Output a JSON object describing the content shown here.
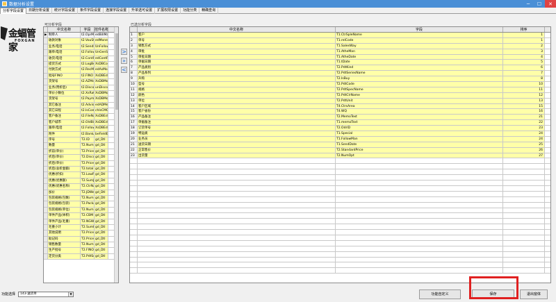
{
  "window": {
    "title": "数据分析设置",
    "min": "─",
    "max": "☐",
    "close": "✕"
  },
  "tabs": [
    "分析字段设置",
    "日期分析设置",
    "统计字段设置",
    "条件字段设置",
    "连接字段设置",
    "升单选可设置",
    "扩展权限设置",
    "功能分类",
    "精确查询"
  ],
  "logo": {
    "brand": "金蝠管家",
    "latin": "FOXGAN"
  },
  "left": {
    "group_label": "可分析字段",
    "headers": [
      "中文名称",
      "字段",
      "控件名称"
    ],
    "rows": [
      [
        "制单人",
        "t2.OprMan",
        "edBillMan"
      ],
      [
        "收款对象",
        "t2.VouState",
        "edMoneyObj"
      ],
      [
        "业务/电话",
        "t2.SendMan",
        "UnFollowM"
      ],
      [
        "跟单/电话",
        "t2.FollowMan",
        "UnGenSup"
      ],
      [
        "收货/电话",
        "t2.ContPhone",
        "edContPho"
      ],
      [
        "提货方式",
        "t2.LogBookId",
        "XsDBCombo"
      ],
      [
        "付款方式",
        "t2.RecMoney",
        "edAsMone"
      ],
      [
        "批号FINO",
        "t2.FINO",
        "XsDBEdit1"
      ],
      [
        "货架号",
        "t2.AZMoney",
        "XsDBMoney"
      ],
      [
        "业务(用折后)",
        "t2.Discount",
        "unDiscout"
      ],
      [
        "单价小数位",
        "t2.XsRate",
        "XsDBMoney"
      ],
      [
        "货架号",
        "t2.PaymentMode",
        "XsDBMoney"
      ],
      [
        "其它备注",
        "t2.Advising",
        "edADMemo"
      ],
      [
        "其它日程",
        "t2.IsCommon",
        "chIsCMO"
      ],
      [
        "客户备注",
        "t2.FileName",
        "XsDBEdit1"
      ],
      [
        "客户城市",
        "t2.OldBill",
        "XsDBEdit1"
      ],
      [
        "跟单/电话",
        "t2.FollowMan",
        "XsDBEdit1"
      ],
      [
        "附件",
        "t2.BankAddr",
        "beFieldE"
      ],
      [
        "序号",
        "T2.ID",
        "gd_Dtl"
      ],
      [
        "数量",
        "T2.Number",
        "gd_Dtl"
      ],
      [
        "折前(单价)",
        "T2.Price",
        "gd_Dtl"
      ],
      [
        "折后(单价)",
        "T2.Discount",
        "gd_Dtl"
      ],
      [
        "折后(单价)",
        "T2.PriceDis",
        "gd_Dtl"
      ],
      [
        "折后(总折金额)",
        "T2.total",
        "gd_Dtl"
      ],
      [
        "优惠(折扣)",
        "T2.LowPrice",
        "gd_Dtl"
      ],
      [
        "优惠(优惠额)",
        "T2.SumJDPrice",
        "gd_Dtl"
      ],
      [
        "优惠(优惠名称)",
        "T2.CtrName2",
        "gd_Dtl"
      ],
      [
        "加价",
        "T2.JDWeight",
        "gd_Dtl"
      ],
      [
        "包装规格(包数)",
        "T2.NumBox",
        "gd_Dtl"
      ],
      [
        "包装规格(包装)",
        "T2.PackageT",
        "gd_Dtl"
      ],
      [
        "包装规格(单位)",
        "T2.NumPacks",
        "gd_Dtl"
      ],
      [
        "单件产品(体积)",
        "T2.CBM",
        "gd_Dtl"
      ],
      [
        "单件产品(毛重)",
        "T2.NGWeight",
        "gd_Dtl"
      ],
      [
        "毛重小计",
        "T2.SumNGWei",
        "gd_Dtl"
      ],
      [
        "其他说明",
        "T2.PriceMem",
        "gd_Dtl"
      ],
      [
        "助记码",
        "T2.PriceLog",
        "gd_Dtl"
      ],
      [
        "销售数量",
        "T2.NumReq",
        "gd_Dtl"
      ],
      [
        "生产批号",
        "T2.FINO",
        "gd_Dtl"
      ],
      [
        "定货分类",
        "T2.PdtSort",
        "gd_Dtl"
      ]
    ],
    "selected_index": 0
  },
  "arrows": [
    ">",
    "»",
    "<"
  ],
  "right": {
    "group_label": "已选分析字段",
    "headers": [
      "中文名称",
      "字段",
      "排序"
    ],
    "rows": [
      [
        "客户",
        "T1.CtrSpleName",
        "1"
      ],
      [
        "单号",
        "T1.relCode",
        "1"
      ],
      [
        "销售方式",
        "T1.SalesWay",
        "2"
      ],
      [
        "审批",
        "T1.AtheMan",
        "3"
      ],
      [
        "审批日期",
        "T1.AtheDate",
        "4"
      ],
      [
        "单据日期",
        "T1.tDate",
        "5"
      ],
      [
        "产品类别",
        "T2.PdtKind",
        "6"
      ],
      [
        "产品系列",
        "T2.PdtSeriesName",
        "7"
      ],
      [
        "升购",
        "T2.IsBuy",
        "8"
      ],
      [
        "型号",
        "T2.PdtCode",
        "10"
      ],
      [
        "规格",
        "T2.PdtSpecName",
        "11"
      ],
      [
        "颜色",
        "T2.PdtClrName",
        "12"
      ],
      [
        "单位",
        "T2.PdtUnit",
        "13"
      ],
      [
        "客户区域",
        "T4.CtrsArea",
        "15"
      ],
      [
        "客户省份",
        "T4.WQ",
        "16"
      ],
      [
        "产品备注",
        "T2.MemoText",
        "21"
      ],
      [
        "单据备注",
        "T1.memoText",
        "22"
      ],
      [
        "订货单号",
        "T2.OdrID",
        "23"
      ],
      [
        "特运类",
        "T1.Special",
        "24"
      ],
      [
        "业务员",
        "T1.FollowMan",
        "24"
      ],
      [
        "送货日期",
        "T1.SendDate",
        "25"
      ],
      [
        "正常售价",
        "T2.StandardPrice",
        "26"
      ],
      [
        "出货量",
        "T2.NumOpt",
        "27"
      ]
    ]
  },
  "bottom": {
    "func_label": "功能选择",
    "func_value": "143-送货单",
    "custom_button": "功能自定义",
    "save_button": "保存",
    "exit_button": "退出窗体"
  }
}
